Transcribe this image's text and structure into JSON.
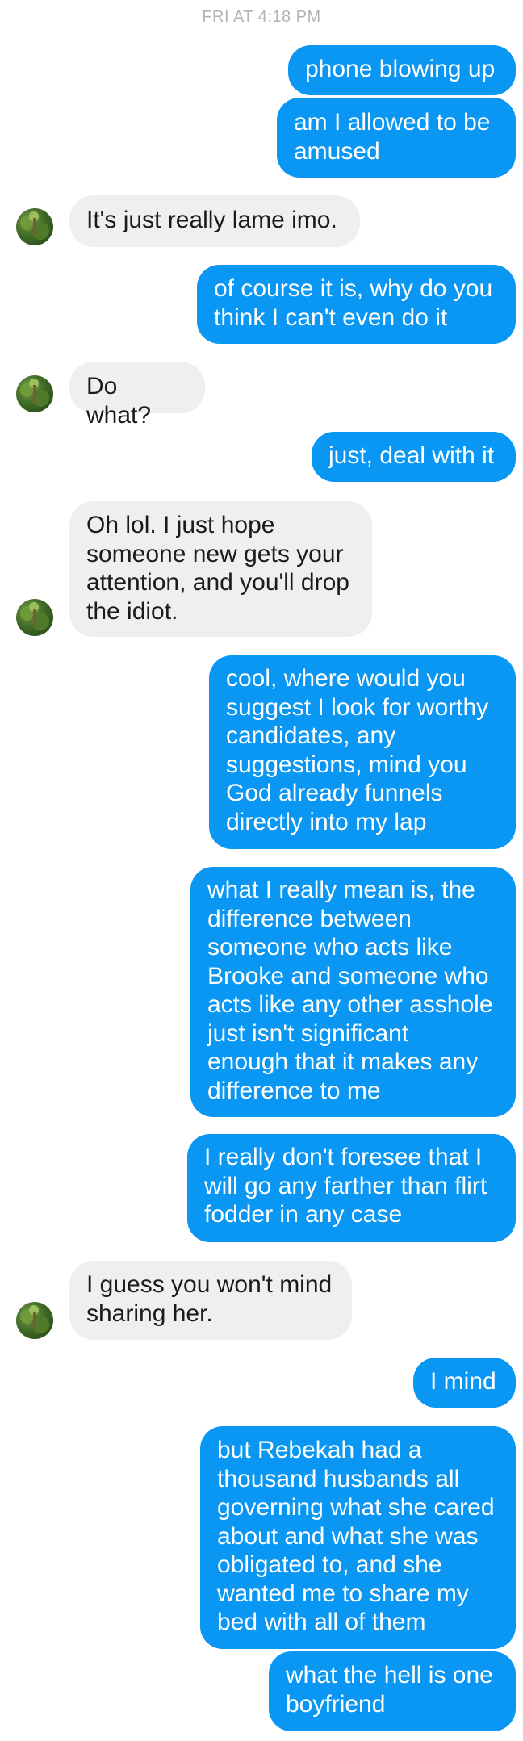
{
  "conversation": {
    "timestamp": "FRI AT 4:18 PM",
    "messages": [
      {
        "from": "me",
        "text": "phone blowing up"
      },
      {
        "from": "me",
        "text": "am I allowed to be\namused"
      },
      {
        "from": "them",
        "text": "It's just really lame imo."
      },
      {
        "from": "me",
        "text": "of course it is, why do you\nthink I can't even do it"
      },
      {
        "from": "them",
        "text": "Do what?"
      },
      {
        "from": "me",
        "text": "just, deal with it"
      },
      {
        "from": "them",
        "text": "Oh lol. I just hope\nsomeone new gets your\nattention, and you'll drop\nthe idiot."
      },
      {
        "from": "me",
        "text": "cool, where would you\nsuggest I look for worthy\ncandidates, any\nsuggestions, mind you\nGod already funnels\ndirectly into my lap"
      },
      {
        "from": "me",
        "text": "what I really mean is, the\ndifference between\nsomeone who acts like\nBrooke and someone who\nacts like any other asshole\njust isn't significant\nenough that it makes any\ndifference to me"
      },
      {
        "from": "me",
        "text": "I really don't foresee that I\nwill go any farther than flirt\nfodder in any case"
      },
      {
        "from": "them",
        "text": "I guess you won't mind\nsharing her."
      },
      {
        "from": "me",
        "text": "I mind"
      },
      {
        "from": "me",
        "text": "but Rebekah had a\nthousand husbands all\ngoverning what she cared\nabout and what she was\nobligated to, and she\nwanted me to share my\nbed with all of them"
      },
      {
        "from": "me",
        "text": "what the hell is one\nboyfriend"
      }
    ]
  },
  "colors": {
    "outgoing_bubble": "#0a96f3",
    "incoming_bubble": "#efefef",
    "timestamp_text": "#b3b3b3"
  },
  "icons": {
    "contact_avatar": "avatar-photo-icon"
  }
}
